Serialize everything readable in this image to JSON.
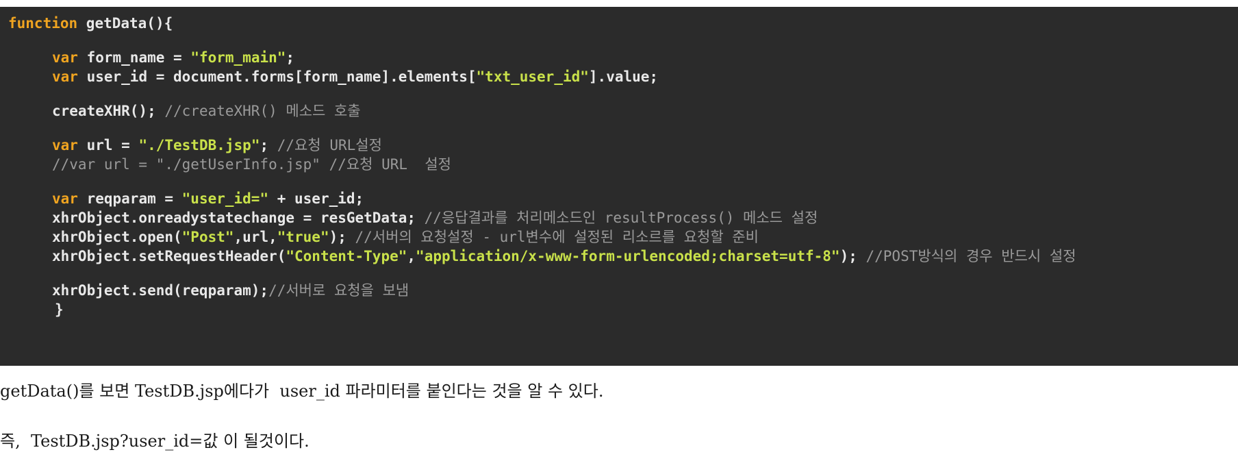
{
  "code": {
    "language": "javascript",
    "lines": [
      [
        {
          "t": "kw",
          "v": "function"
        },
        {
          "t": "pln",
          "v": " getData(){"
        }
      ],
      [],
      [
        {
          "t": "kw",
          "v": "var"
        },
        {
          "t": "pln",
          "v": " form_name = "
        },
        {
          "t": "str",
          "v": "\"form_main\""
        },
        {
          "t": "pln",
          "v": ";"
        }
      ],
      [
        {
          "t": "kw",
          "v": "var"
        },
        {
          "t": "pln",
          "v": " user_id = document.forms[form_name].elements["
        },
        {
          "t": "str",
          "v": "\"txt_user_id\""
        },
        {
          "t": "pln",
          "v": "].value;"
        }
      ],
      [],
      [
        {
          "t": "pln",
          "v": "createXHR(); "
        },
        {
          "t": "cmt",
          "v": "//createXHR() 메소드 호출"
        }
      ],
      [],
      [
        {
          "t": "kw",
          "v": "var"
        },
        {
          "t": "pln",
          "v": " url = "
        },
        {
          "t": "str",
          "v": "\"./TestDB.jsp\""
        },
        {
          "t": "pln",
          "v": "; "
        },
        {
          "t": "cmt",
          "v": "//요청 URL설정"
        }
      ],
      [
        {
          "t": "cmt",
          "v": "//var url = \"./getUserInfo.jsp\" //요청 URL  설정"
        }
      ],
      [],
      [
        {
          "t": "kw",
          "v": "var"
        },
        {
          "t": "pln",
          "v": " reqparam = "
        },
        {
          "t": "str",
          "v": "\"user_id=\""
        },
        {
          "t": "pln",
          "v": " + user_id;"
        }
      ],
      [
        {
          "t": "pln",
          "v": "xhrObject.onreadystatechange = resGetData; "
        },
        {
          "t": "cmt",
          "v": "//응답결과를 처리메소드인 resultProcess() 메소드 설정"
        }
      ],
      [
        {
          "t": "pln",
          "v": "xhrObject.open("
        },
        {
          "t": "str",
          "v": "\"Post\""
        },
        {
          "t": "pln",
          "v": ",url,"
        },
        {
          "t": "str",
          "v": "\"true\""
        },
        {
          "t": "pln",
          "v": "); "
        },
        {
          "t": "cmt",
          "v": "//서버의 요청설정 - url변수에 설정된 리소르를 요청할 준비"
        }
      ],
      [
        {
          "t": "pln",
          "v": "xhrObject.setRequestHeader("
        },
        {
          "t": "str",
          "v": "\"Content-Type\""
        },
        {
          "t": "pln",
          "v": ","
        },
        {
          "t": "str",
          "v": "\"application/x-www-form-urlencoded;charset=utf-8\""
        },
        {
          "t": "pln",
          "v": "); "
        },
        {
          "t": "cmt",
          "v": "//POST방식의 경우 반드시 설정"
        }
      ],
      [],
      [
        {
          "t": "pln",
          "v": "xhrObject.send(reqparam);"
        },
        {
          "t": "cmt",
          "v": "//서버로 요청을 보냄"
        }
      ],
      [
        {
          "t": "pln",
          "v": "}"
        }
      ]
    ]
  },
  "prose": {
    "line1": "getData()를 보면 TestDB.jsp에다가  user_id 파라미터를 붙인다는 것을 알 수 있다.",
    "line2": "즉,  TestDB.jsp?user_id=값 이 될것이다."
  },
  "colors": {
    "code_bg": "#2b2b2b",
    "keyword": "#f0a420",
    "string": "#c9e14a",
    "comment": "#9a9a9a",
    "plain": "#e8e8e8"
  }
}
